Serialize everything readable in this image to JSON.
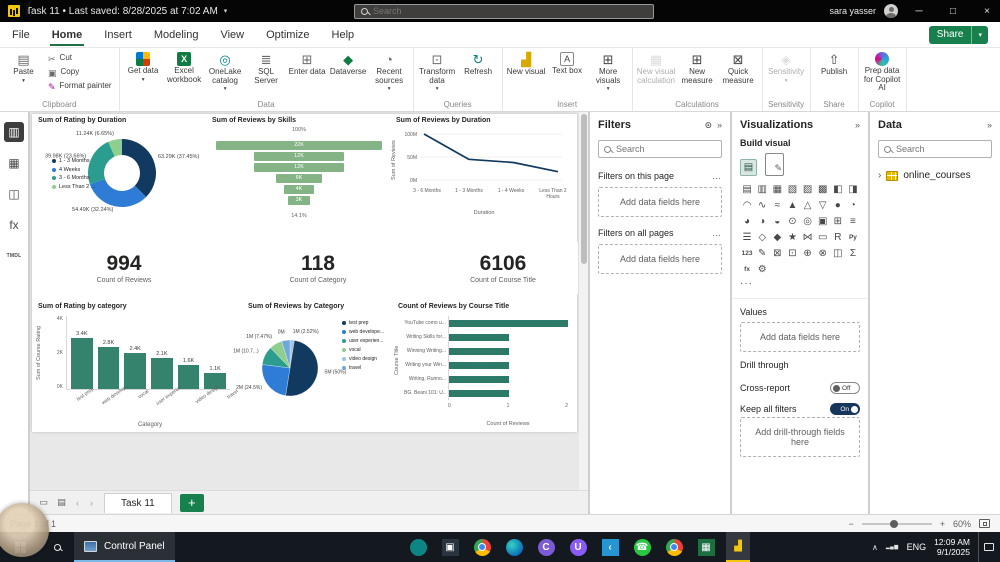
{
  "titlebar": {
    "title": "Task 11  •  Last saved: 8/28/2025 at 7:02 AM",
    "search_placeholder": "Search",
    "user_name": "sara yasser"
  },
  "menubar": {
    "items": [
      "File",
      "Home",
      "Insert",
      "Modeling",
      "View",
      "Optimize",
      "Help"
    ],
    "active": "Home",
    "share_label": "Share"
  },
  "ribbon": {
    "groups": [
      {
        "label": "Clipboard",
        "buttons": [
          {
            "label": "Paste",
            "size": "lg",
            "glyph": "▤",
            "color": "#6b6b6b",
            "arrow": true
          },
          {
            "label": "Cut",
            "size": "sm",
            "glyph": "✂",
            "color": "#6b6b6b"
          },
          {
            "label": "Copy",
            "size": "sm",
            "glyph": "▣",
            "color": "#6b6b6b"
          },
          {
            "label": "Format painter",
            "size": "sm",
            "glyph": "✎",
            "color": "#b4009e"
          }
        ]
      },
      {
        "label": "Data",
        "buttons": [
          {
            "label": "Get data",
            "size": "lg",
            "cls": "ic-colorgrid",
            "arrow": true
          },
          {
            "label": "Excel workbook",
            "size": "lg",
            "cls": "ic-excel",
            "glyph": "X"
          },
          {
            "label": "OneLake catalog",
            "size": "lg",
            "glyph": "◎",
            "color": "#038387",
            "arrow": true
          },
          {
            "label": "SQL Server",
            "size": "lg",
            "glyph": "≣",
            "color": "#6b6b6b"
          },
          {
            "label": "Enter data",
            "size": "lg",
            "glyph": "⊞",
            "color": "#6b6b6b"
          },
          {
            "label": "Dataverse",
            "size": "lg",
            "glyph": "◆",
            "color": "#107c41"
          },
          {
            "label": "Recent sources",
            "size": "lg",
            "glyph": "◔",
            "color": "#6b6b6b",
            "arrow": true
          }
        ]
      },
      {
        "label": "Queries",
        "buttons": [
          {
            "label": "Transform data",
            "size": "lg",
            "glyph": "⊡",
            "color": "#6b6b6b",
            "arrow": true
          },
          {
            "label": "Refresh",
            "size": "lg",
            "glyph": "↻",
            "color": "#038387"
          }
        ]
      },
      {
        "label": "Insert",
        "buttons": [
          {
            "label": "New visual",
            "size": "lg",
            "glyph": "▟",
            "color": "#d9a800"
          },
          {
            "label": "Text box",
            "size": "lg",
            "glyph": "A",
            "color": "#444444",
            "cls": "ic-box"
          },
          {
            "label": "More visuals",
            "size": "lg",
            "glyph": "⊞",
            "color": "#444444",
            "arrow": true
          }
        ]
      },
      {
        "label": "Calculations",
        "buttons": [
          {
            "label": "New visual calculation",
            "size": "lg",
            "glyph": "▦",
            "color": "#b0aeac",
            "disabled": true
          },
          {
            "label": "New measure",
            "size": "lg",
            "glyph": "⊞",
            "color": "#444444"
          },
          {
            "label": "Quick measure",
            "size": "lg",
            "glyph": "⊠",
            "color": "#444444"
          }
        ]
      },
      {
        "label": "Sensitivity",
        "buttons": [
          {
            "label": "Sensitivity",
            "size": "lg",
            "glyph": "◈",
            "color": "#b0aeac",
            "disabled": true,
            "arrow": true
          }
        ]
      },
      {
        "label": "Share",
        "buttons": [
          {
            "label": "Publish",
            "size": "lg",
            "glyph": "⇧",
            "color": "#444444"
          }
        ]
      },
      {
        "label": "Copilot",
        "buttons": [
          {
            "label": "Prep data for Copilot AI",
            "size": "lg",
            "cls": "ic-copilot"
          }
        ]
      }
    ]
  },
  "view_strip": {
    "items": [
      {
        "name": "report-view",
        "glyph": "▥",
        "active": true
      },
      {
        "name": "table-view",
        "glyph": "▦",
        "active": false
      },
      {
        "name": "model-view",
        "glyph": "◫",
        "active": false
      },
      {
        "name": "dax-query-view",
        "glyph": "fx",
        "active": false
      },
      {
        "name": "tmdl-view",
        "glyph": "TMDL",
        "active": false
      }
    ]
  },
  "chart_data": {
    "donut": {
      "type": "pie",
      "title": "Sum of Rating by Duration",
      "slices": [
        {
          "name": "1 - 3 Months",
          "label": "63.29K (37.45%)",
          "pct": 37.45,
          "color": "#12395f"
        },
        {
          "name": "4 Weeks",
          "label": "54.49K (32.24%)",
          "pct": 32.24,
          "color": "#2e7cd6"
        },
        {
          "name": "3 - 6 Months",
          "label": "39.98K (23.66%)",
          "pct": 23.66,
          "color": "#2a9d8f"
        },
        {
          "name": "Less Than 2 ...",
          "label": "11.24K (6.65%)",
          "pct": 6.65,
          "color": "#8fce8f"
        }
      ]
    },
    "funnel": {
      "type": "bar",
      "title": "Sum of Reviews by Skills",
      "top_label": "100%",
      "bottom_label": "14.1%",
      "color": "#84b385",
      "bars": [
        {
          "label": "22K",
          "value": 22
        },
        {
          "label": "12K",
          "value": 12
        },
        {
          "label": "12K",
          "value": 12
        },
        {
          "label": "6K",
          "value": 6
        },
        {
          "label": "4K",
          "value": 4
        },
        {
          "label": "3K",
          "value": 3
        }
      ]
    },
    "line": {
      "type": "line",
      "title": "Sum of Reviews by Duration",
      "ylabel": "Sum of Reviews",
      "xlabel": "Duration",
      "yticks": [
        "100M",
        "50M",
        "0M"
      ],
      "ymax": 100,
      "categories": [
        "3 - 6 Months",
        "1 - 3 Months",
        "1 - 4 Weeks",
        "Less Than 2 Hours"
      ],
      "values": [
        100,
        45,
        38,
        18
      ],
      "color": "#12395f"
    },
    "cards": [
      {
        "value": "994",
        "label": "Count of Reviews"
      },
      {
        "value": "118",
        "label": "Count of Category"
      },
      {
        "value": "6106",
        "label": "Count of Course Title"
      }
    ],
    "bar": {
      "type": "bar",
      "title": "Sum of Rating by category",
      "ylabel": "Sum of Course Rating",
      "xlabel": "Category",
      "yticks": [
        "4K",
        "2K",
        "0K"
      ],
      "ymax": 4,
      "color": "#35836d",
      "bars": [
        {
          "category": "test prep",
          "label": "3.4K",
          "value": 3.4
        },
        {
          "category": "web develop...",
          "label": "2.8K",
          "value": 2.8
        },
        {
          "category": "vocal",
          "label": "2.4K",
          "value": 2.4
        },
        {
          "category": "user experien...",
          "label": "2.1K",
          "value": 2.1
        },
        {
          "category": "video design",
          "label": "1.6K",
          "value": 1.6
        },
        {
          "category": "travel",
          "label": "1.1K",
          "value": 1.1
        }
      ]
    },
    "pie": {
      "type": "pie",
      "title": "Sum of Reviews by Category",
      "slices": [
        {
          "label": "1M (2.52%)",
          "pct": 2.52,
          "color": "#9dc3e6"
        },
        {
          "label": "5M (50%)",
          "pct": 50,
          "color": "#12395f"
        },
        {
          "label": "2M (24.5%)",
          "pct": 24.5,
          "color": "#2e7cd6"
        },
        {
          "label": "1M (10.7...)",
          "pct": 10.7,
          "color": "#2a9d8f"
        },
        {
          "label": "1M (7.47%)",
          "pct": 7.47,
          "color": "#8fce8f"
        },
        {
          "label": "0M",
          "pct": 4.81,
          "color": "#6fa8dc"
        }
      ],
      "legend": [
        {
          "label": "test prep",
          "color": "#12395f"
        },
        {
          "label": "web develope...",
          "color": "#2e7cd6"
        },
        {
          "label": "user experien...",
          "color": "#2a9d8f"
        },
        {
          "label": "vocal",
          "color": "#8fce8f"
        },
        {
          "label": "video design",
          "color": "#9dc3e6"
        },
        {
          "label": "travel",
          "color": "#6fa8dc"
        }
      ]
    },
    "hbar": {
      "type": "bar-horizontal",
      "title": "Count of Reviews by Course Title",
      "ylabel": "Course Title",
      "xlabel": "Count of Reviews",
      "xticks": [
        "0",
        "1",
        "2"
      ],
      "xmax": 2,
      "color": "#2e7a68",
      "bars": [
        {
          "category": "YouTube como u...",
          "value": 2
        },
        {
          "category": "Writing Skills for...",
          "value": 1
        },
        {
          "category": "Winning Writing...",
          "value": 1
        },
        {
          "category": "Writing your Win...",
          "value": 1
        },
        {
          "category": "Writing, Runno...",
          "value": 1
        },
        {
          "category": "BG. Beani 101: U...",
          "value": 1
        }
      ]
    }
  },
  "filters_pane": {
    "title": "Filters",
    "search_placeholder": "Search",
    "sections": [
      {
        "title": "Filters on this page",
        "placeholder": "Add data fields here"
      },
      {
        "title": "Filters on all pages",
        "placeholder": "Add data fields here"
      }
    ]
  },
  "viz_pane": {
    "title": "Visualizations",
    "build_label": "Build visual",
    "icons": [
      "▤",
      "▥",
      "▦",
      "▧",
      "▨",
      "▩",
      "◧",
      "◨",
      "◠",
      "∿",
      "≈",
      "▲",
      "△",
      "▽",
      "●",
      "◔",
      "◕",
      "◑",
      "◒",
      "⊙",
      "◎",
      "▣",
      "⊞",
      "≡",
      "☰",
      "◇",
      "◆",
      "★",
      "⋈",
      "▭",
      "R",
      "Py",
      "123",
      "✎",
      "⊠",
      "⊡",
      "⊕",
      "⊗",
      "◫",
      "Σ",
      "fx",
      "⚙"
    ],
    "more": "···",
    "values_label": "Values",
    "values_placeholder": "Add data fields here",
    "drill_label": "Drill through",
    "cross_report_label": "Cross-report",
    "cross_report_state": "Off",
    "keep_filters_label": "Keep all filters",
    "keep_filters_state": "On",
    "drill_placeholder": "Add drill-through fields here"
  },
  "data_pane": {
    "title": "Data",
    "search_placeholder": "Search",
    "items": [
      {
        "label": "online_courses"
      }
    ]
  },
  "tabstrip": {
    "tabs": [
      {
        "label": "Task 11",
        "active": true
      }
    ],
    "add_label": "+"
  },
  "statusbar": {
    "page_indicator": "Page 1 of 1",
    "zoom": "60%"
  },
  "taskbar": {
    "app_button": "Control Panel",
    "lang": "ENG",
    "time": "12:09 AM",
    "date": "9/1/2025",
    "apps": [
      {
        "name": "meet-app-icon",
        "color": "#0e8585",
        "shape": "circle"
      },
      {
        "name": "photos-app-icon",
        "color": "#2a3440",
        "glyph": "▣"
      },
      {
        "name": "chrome-icon",
        "cls": "ic-chrome"
      },
      {
        "name": "edge-icon",
        "cls": "ic-edge"
      },
      {
        "name": "copilot-app-icon",
        "color": "#7b5cd6",
        "shape": "circle",
        "glyph": "C"
      },
      {
        "name": "u-app-icon",
        "color": "#8a5cf5",
        "shape": "circle",
        "glyph": "U"
      },
      {
        "name": "vscode-icon",
        "color": "#2596d1",
        "glyph": "‹"
      },
      {
        "name": "whatsapp-icon",
        "color": "#28c840",
        "shape": "circle",
        "glyph": "☎"
      },
      {
        "name": "browser-app-icon",
        "cls": "ic-chrome"
      },
      {
        "name": "excel-app-icon",
        "color": "#1d6f42",
        "glyph": "▦"
      },
      {
        "name": "powerbi-icon",
        "color": "transparent",
        "glyph": "▟",
        "glyph_color": "#f2c80f",
        "active": true
      }
    ]
  },
  "icons": {
    "caret_down": "▾",
    "minimize": "─",
    "maximize": "□",
    "close": "×",
    "collapse": "»",
    "eye": "⊙",
    "more_horizontal": "…",
    "chevron_left": "‹",
    "chevron_right": "›",
    "chevron_up": "∧",
    "chevron_expand": "›",
    "signal": "▂▄▆",
    "minus": "−",
    "plus": "+",
    "build_selected": "▤",
    "build_pencil": "✎",
    "tab_doc1": "▭",
    "tab_doc2": "▤"
  }
}
